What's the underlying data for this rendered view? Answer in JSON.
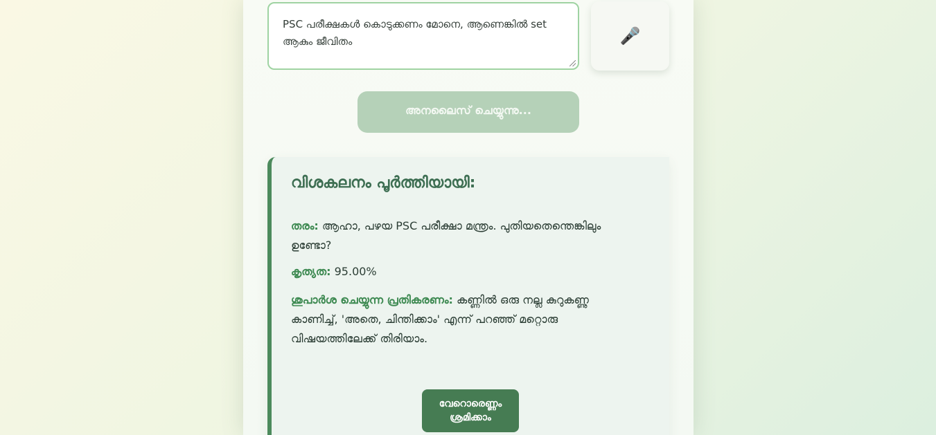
{
  "input": {
    "value": "PSC പരീക്ഷകൾ കൊടുക്കണം മോനെ, ആണെങ്കിൽ set ആകും ജീവിതം"
  },
  "mic": {
    "icon": "microphone-icon",
    "glyph": "🎤"
  },
  "analyze_button": {
    "label": "അനലൈസ് ചെയ്യുന്നു..."
  },
  "result": {
    "title": "വിശകലനം പൂർത്തിയായി:",
    "type_label": "തരം:",
    "type_value": "ആഹാ, പഴയ PSC പരീക്ഷാ മന്ത്രം. പുതിയതെന്തെങ്കിലും ഉണ്ടോ?",
    "accuracy_label": "കൃത്യത:",
    "accuracy_value": "95.00%",
    "suggestion_label": "ശുപാർശ ചെയ്യുന്ന പ്രതികരണം:",
    "suggestion_value": "കണ്ണിൽ ഒരു നല്ല കുറുകണ്ണു കാണിച്ച്, 'അതെ, ചിന്തിക്കാം' എന്ന് പറഞ്ഞ് മറ്റൊരു വിഷയത്തിലേക്ക് തിരിയാം."
  },
  "retry_button": {
    "line1": "വേറൊരെണ്ണം",
    "line2": "ശ്രമിക്കാം"
  },
  "colors": {
    "accent": "#467c53",
    "input_border": "#9fd3a2",
    "disabled_button": "#b5d1b8"
  }
}
